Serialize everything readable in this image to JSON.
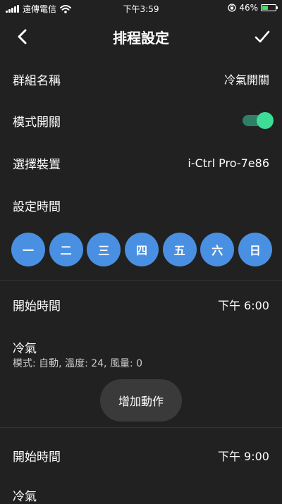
{
  "status_bar": {
    "carrier": "遠傳電信",
    "time": "下午3:59",
    "battery_percent": "46%",
    "battery_level": 0.46
  },
  "nav": {
    "title": "排程設定",
    "back_icon": "chevron-left-icon",
    "confirm_icon": "checkmark-icon"
  },
  "form": {
    "group_name_label": "群組名稱",
    "group_name_value": "冷氣開關",
    "mode_switch_label": "模式開關",
    "mode_switch_on": true,
    "device_label": "選擇裝置",
    "device_value": "i-Ctrl Pro-7e86",
    "time_label": "設定時間"
  },
  "days": [
    "一",
    "二",
    "三",
    "四",
    "五",
    "六",
    "日"
  ],
  "schedules": [
    {
      "start_label": "開始時間",
      "start_value": "下午 6:00",
      "action_title": "冷氣",
      "action_detail": "模式: 自動, 溫度: 24, 風量: 0"
    },
    {
      "start_label": "開始時間",
      "start_value": "下午 9:00",
      "action_title": "冷氣"
    }
  ],
  "add_action_label": "增加動作",
  "colors": {
    "background": "#212121",
    "day_button": "#4a90e2",
    "toggle_knob": "#3ddc97",
    "toggle_track": "#2e7f66",
    "battery_fill": "#4cd964"
  }
}
